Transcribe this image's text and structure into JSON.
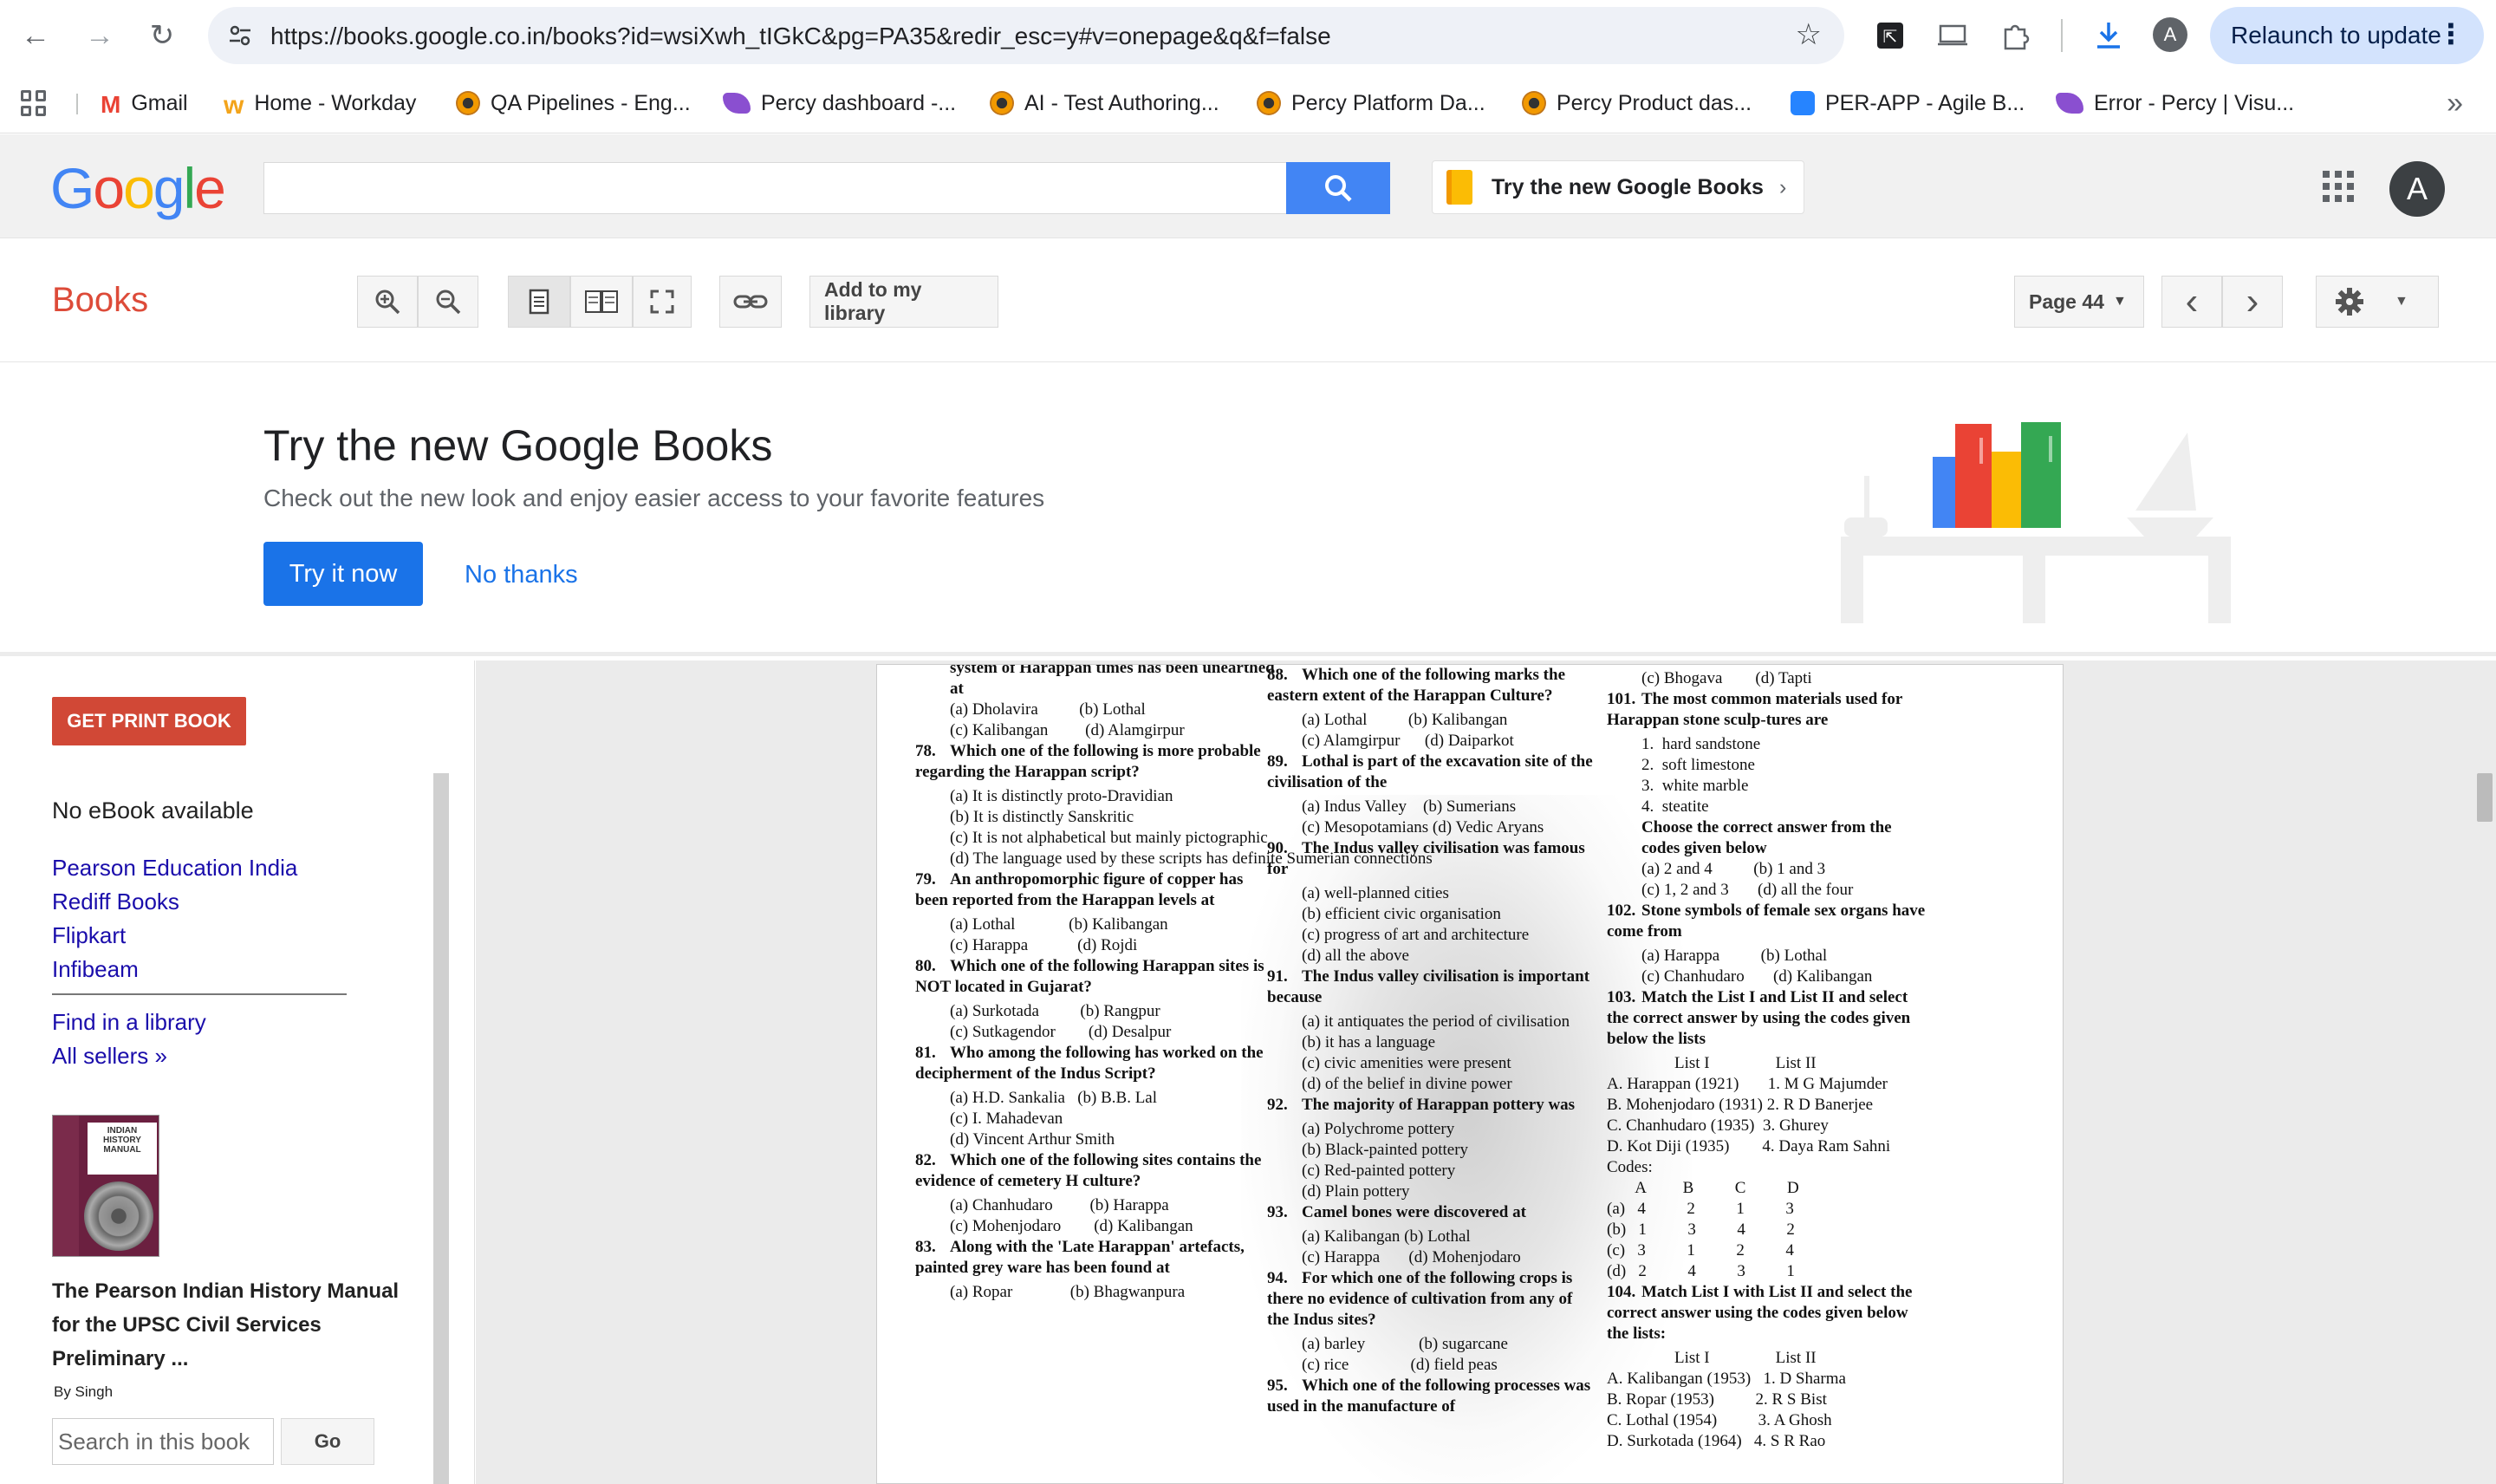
{
  "browser": {
    "url": "https://books.google.co.in/books?id=wsiXwh_tIGkC&pg=PA35&redir_esc=y#v=onepage&q&f=false",
    "profile_initial": "A",
    "relaunch_label": "Relaunch to update"
  },
  "bookmarks": [
    {
      "label": "Gmail",
      "icon": "gmail-icon"
    },
    {
      "label": "Home - Workday",
      "icon": "workday-icon"
    },
    {
      "label": "QA Pipelines - Eng...",
      "icon": "chrome-circle-icon"
    },
    {
      "label": "Percy dashboard -...",
      "icon": "percy-icon"
    },
    {
      "label": "AI - Test Authoring...",
      "icon": "chrome-circle-icon"
    },
    {
      "label": "Percy Platform Da...",
      "icon": "chrome-circle-icon"
    },
    {
      "label": "Percy Product das...",
      "icon": "chrome-circle-icon"
    },
    {
      "label": "PER-APP - Agile B...",
      "icon": "jira-icon"
    },
    {
      "label": "Error - Percy | Visu...",
      "icon": "percy-icon"
    }
  ],
  "google_header": {
    "try_new_books": "Try the new Google Books",
    "avatar_initial": "A"
  },
  "books_toolbar": {
    "title": "Books",
    "add_library": "Add to my library",
    "page_label": "Page 44"
  },
  "promo": {
    "title": "Try the new Google Books",
    "subtitle": "Check out the new look and enjoy easier access to your favorite features",
    "try_now": "Try it now",
    "no_thanks": "No thanks"
  },
  "sidebar": {
    "get_print": "GET PRINT BOOK",
    "no_ebook": "No eBook available",
    "stores": [
      "Pearson Education India",
      "Rediff Books",
      "Flipkart",
      "Infibeam"
    ],
    "find_library": "Find in a library",
    "all_sellers": "All sellers »",
    "cover_text": "INDIAN HISTORY MANUAL",
    "book_title": "The Pearson Indian History Manual for the UPSC Civil Services Preliminary ...",
    "author": "By Singh",
    "search_placeholder": "Search in this book",
    "go": "Go"
  },
  "page_content": {
    "col1": [
      {
        "t": "system of Harappan times has been unearthed at"
      },
      {
        "o": "(a) Dholavira          (b) Lothal"
      },
      {
        "o": "(c) Kalibangan         (d) Alamgirpur"
      },
      {
        "n": "78.",
        "t": "Which one of the following is more probable regarding the Harappan script?"
      },
      {
        "o": "(a) It is distinctly proto-Dravidian"
      },
      {
        "o": "(b) It is distinctly Sanskritic"
      },
      {
        "o": "(c) It is not alphabetical but mainly pictographic"
      },
      {
        "o": "(d) The language used by these scripts has definite Sumerian connections"
      },
      {
        "n": "79.",
        "t": "An anthropomorphic figure of copper has been reported from the Harappan levels at"
      },
      {
        "o": "(a) Lothal             (b) Kalibangan"
      },
      {
        "o": "(c) Harappa            (d) Rojdi"
      },
      {
        "n": "80.",
        "t": "Which one of the following Harappan sites is NOT located in Gujarat?"
      },
      {
        "o": "(a) Surkotada          (b) Rangpur"
      },
      {
        "o": "(c) Sutkagendor        (d) Desalpur"
      },
      {
        "n": "81.",
        "t": "Who among the following has worked on the decipherment of the Indus Script?"
      },
      {
        "o": "(a) H.D. Sankalia   (b) B.B. Lal"
      },
      {
        "o": "(c) I. Mahadevan"
      },
      {
        "o": "(d) Vincent Arthur Smith"
      },
      {
        "n": "82.",
        "t": "Which one of the following sites contains the evidence of cemetery H culture?"
      },
      {
        "o": "(a) Chanhudaro         (b) Harappa"
      },
      {
        "o": "(c) Mohenjodaro        (d) Kalibangan"
      },
      {
        "n": "83.",
        "t": "Along with the 'Late Harappan' artefacts, painted grey ware has been found at"
      },
      {
        "o": "(a) Ropar              (b) Bhagwanpura"
      }
    ],
    "col2": [
      {
        "n": "88.",
        "t": "Which one of the following marks the eastern extent of the Harappan Culture?"
      },
      {
        "o": "(a) Lothal          (b) Kalibangan"
      },
      {
        "o": "(c) Alamgirpur      (d) Daiparkot"
      },
      {
        "n": "89.",
        "t": "Lothal is part of the excavation site of the civilisation of the"
      },
      {
        "o": "(a) Indus Valley    (b) Sumerians"
      },
      {
        "o": "(c) Mesopotamians (d) Vedic Aryans"
      },
      {
        "n": "90.",
        "t": "The Indus valley civilisation was famous for"
      },
      {
        "o": "(a) well-planned cities"
      },
      {
        "o": "(b) efficient civic organisation"
      },
      {
        "o": "(c) progress of art and architecture"
      },
      {
        "o": "(d) all the above"
      },
      {
        "n": "91.",
        "t": "The Indus valley civilisation is important because"
      },
      {
        "o": "(a) it antiquates the period of civilisation"
      },
      {
        "o": "(b) it has a language"
      },
      {
        "o": "(c) civic amenities were present"
      },
      {
        "o": "(d) of the belief in divine power"
      },
      {
        "n": "92.",
        "t": "The majority of Harappan pottery was"
      },
      {
        "o": "(a) Polychrome pottery"
      },
      {
        "o": "(b) Black-painted pottery"
      },
      {
        "o": "(c) Red-painted pottery"
      },
      {
        "o": "(d) Plain pottery"
      },
      {
        "n": "93.",
        "t": "Camel bones were discovered at"
      },
      {
        "o": "(a) Kalibangan (b) Lothal"
      },
      {
        "o": "(c) Harappa       (d) Mohenjodaro"
      },
      {
        "n": "94.",
        "t": "For which one of the following crops is there no evidence of cultivation from any of the Indus sites?"
      },
      {
        "o": "(a) barley             (b) sugarcane"
      },
      {
        "o": "(c) rice               (d) field peas"
      },
      {
        "n": "95.",
        "t": "Which one of the following processes was used in the manufacture of"
      }
    ],
    "col3": [
      {
        "o": "(c) Bhogava        (d) Tapti"
      },
      {
        "n": "101.",
        "t": "The most common materials used for Harappan stone sculp-tures are"
      },
      {
        "o": "1.  hard sandstone"
      },
      {
        "o": "2.  soft limestone"
      },
      {
        "o": "3.  white marble"
      },
      {
        "o": "4.  steatite"
      },
      {
        "t2": "Choose the correct answer from the codes given below"
      },
      {
        "o": "(a) 2 and 4          (b) 1 and 3"
      },
      {
        "o": "(c) 1, 2 and 3       (d) all the four"
      },
      {
        "n": "102.",
        "t": "Stone symbols of female sex organs have come from"
      },
      {
        "o": "(a) Harappa          (b) Lothal"
      },
      {
        "o": "(c) Chanhudaro       (d) Kalibangan"
      },
      {
        "n": "103.",
        "t": "Match the List I and List II and select the correct answer by using the codes given below the lists"
      },
      {
        "o": "        List I                List II"
      },
      {
        "p": "A. Harappan (1921)       1. M G Majumder"
      },
      {
        "p": "B. Mohenjodaro (1931) 2. R D Banerjee"
      },
      {
        "p": "C. Chanhudaro (1935)  3. Ghurey"
      },
      {
        "p": "D. Kot Diji (1935)        4. Daya Ram Sahni"
      },
      {
        "p": "Codes:"
      },
      {
        "p": "       A         B          C          D"
      },
      {
        "p": "(a)   4          2          1          3"
      },
      {
        "p": "(b)   1          3          4          2"
      },
      {
        "p": "(c)   3          1          2          4"
      },
      {
        "p": "(d)   2          4          3          1"
      },
      {
        "n": "104.",
        "t": "Match List I with List II and select the correct answer using the codes given below the lists:"
      },
      {
        "o": "        List I                List II"
      },
      {
        "p": "A. Kalibangan (1953)   1. D Sharma"
      },
      {
        "p": "B. Ropar (1953)          2. R S Bist"
      },
      {
        "p": "C. Lothal (1954)          3. A Ghosh"
      },
      {
        "p": "D. Surkotada (1964)   4. S R Rao"
      }
    ]
  },
  "colors": {
    "books_red": "#dd4b39",
    "print_btn": "#d14836",
    "link_blue": "#1a0dab",
    "primary_blue": "#1a73e8",
    "google_blue": "#4285f4"
  }
}
